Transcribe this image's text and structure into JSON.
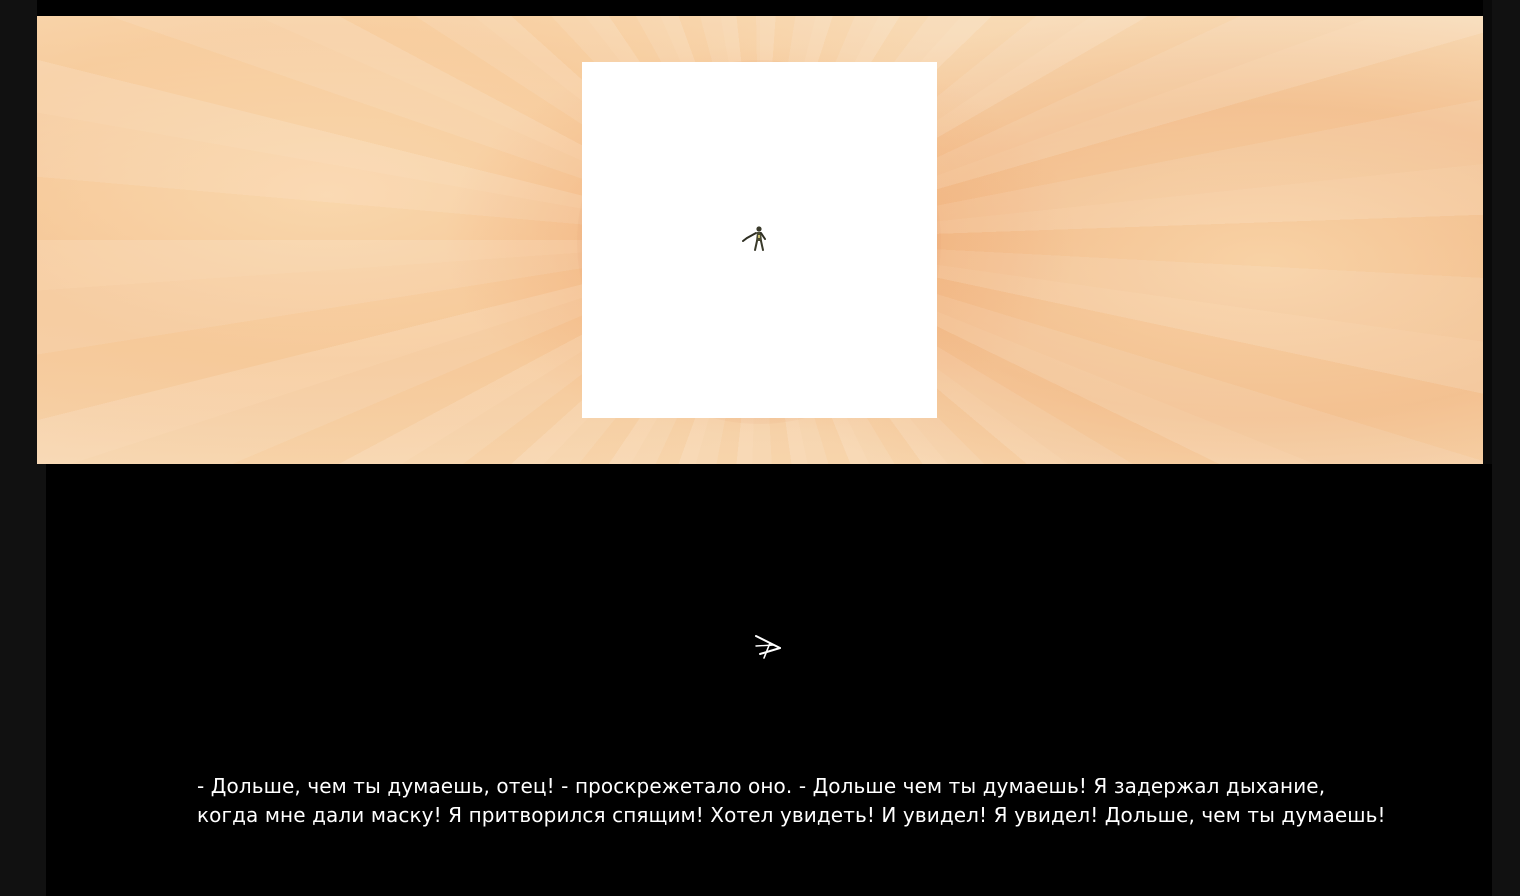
{
  "scene": {
    "background": "swirling-vortex-peach",
    "colors": {
      "vortex_light": "#f7d9b6",
      "vortex_mid": "#f2c59c",
      "vortex_dark": "#d6784a",
      "portal_fill": "#ffffff",
      "panel_bg": "#000000",
      "text": "#ffffff"
    },
    "character_icon": "falling-figure-icon"
  },
  "cursor": {
    "icon": "arrow-cursor-icon"
  },
  "narration": {
    "lines": [
      "- Дольше, чем ты думаешь, отец! - проскрежетало оно. - Дольше чем ты думаешь! Я задержал дыхание,",
      "когда мне дали маску! Я притворился спящим! Хотел увидеть! И увидел! Я увидел! Дольше, чем ты думаешь!"
    ]
  }
}
